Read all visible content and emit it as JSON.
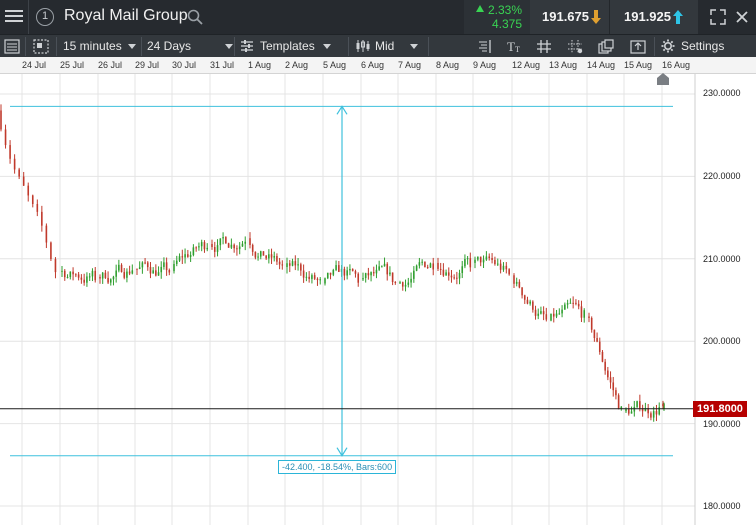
{
  "header": {
    "instrument_name": "Royal Mail Group",
    "info_glyph": "1",
    "change_percent": "2.33%",
    "change_points": "4.375",
    "sell_price": "191.675",
    "buy_price": "191.925",
    "up_color": "#39d353",
    "sell_arrow_color": "#e0a030",
    "buy_arrow_color": "#2ec4e6"
  },
  "toolbar": {
    "interval": "15 minutes",
    "range": "24 Days",
    "templates_label": "Templates",
    "price_type": "Mid",
    "settings_label": "Settings"
  },
  "date_axis": [
    "24 Jul",
    "25 Jul",
    "26 Jul",
    "29 Jul",
    "30 Jul",
    "31 Jul",
    "1 Aug",
    "2 Aug",
    "5 Aug",
    "6 Aug",
    "7 Aug",
    "8 Aug",
    "9 Aug",
    "12 Aug",
    "13 Aug",
    "14 Aug",
    "15 Aug",
    "16 Aug"
  ],
  "price_axis": [
    "230.0000",
    "220.0000",
    "210.0000",
    "200.0000",
    "190.0000",
    "180.0000"
  ],
  "last_price": "191.8000",
  "measure_readout": "-42.400, -18.54%, Bars:600",
  "chart_data": {
    "type": "line",
    "title": "",
    "xlabel": "",
    "ylabel": "",
    "ylim": [
      177.5,
      232.5
    ],
    "x": [
      "24 Jul",
      "25 Jul",
      "26 Jul",
      "29 Jul",
      "30 Jul",
      "31 Jul",
      "1 Aug",
      "2 Aug",
      "5 Aug",
      "6 Aug",
      "7 Aug",
      "8 Aug",
      "9 Aug",
      "12 Aug",
      "13 Aug",
      "14 Aug",
      "15 Aug",
      "16 Aug"
    ],
    "series": [
      {
        "values": [
          227.5,
          208.5,
          207.8,
          208.8,
          208.5,
          211.8,
          212.5,
          209.0,
          207.0,
          207.5,
          207.0,
          209.5,
          209.5,
          208.0,
          202.5,
          203.0,
          191.5,
          191.8
        ]
      }
    ],
    "measure": {
      "high": 228.5,
      "low": 186.1,
      "change": -42.4,
      "change_percent": -18.54,
      "bars": 600
    },
    "last_price": 191.8,
    "grid": true,
    "y_axis_side": "right"
  }
}
